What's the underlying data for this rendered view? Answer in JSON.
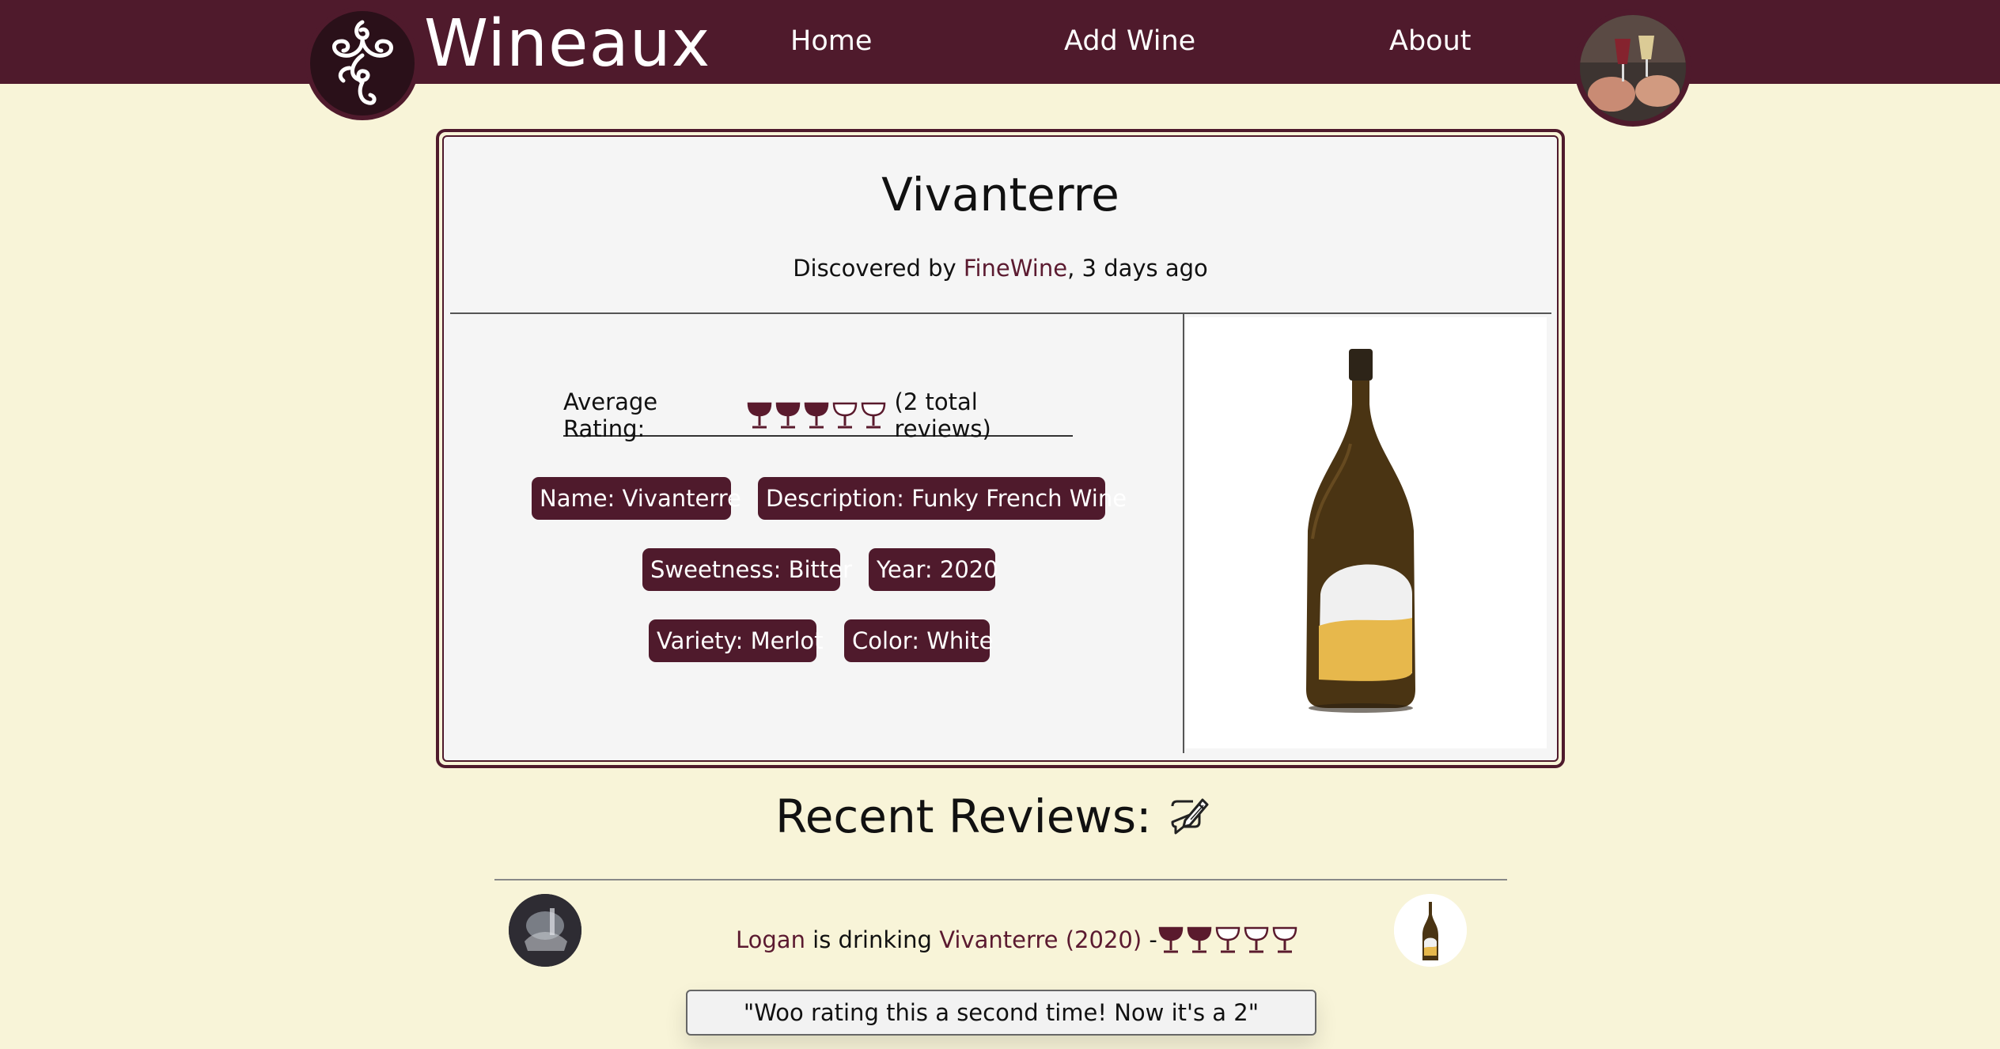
{
  "header": {
    "brand": "Wineaux",
    "nav": [
      {
        "label": "Home"
      },
      {
        "label": "Add Wine"
      },
      {
        "label": "About"
      }
    ]
  },
  "wine": {
    "title": "Vivanterre",
    "discovered_prefix": "Discovered by ",
    "discovered_user": "FineWine",
    "discovered_suffix": ", 3 days ago",
    "rating_label": "Average Rating:",
    "rating_value": 3,
    "rating_max": 5,
    "reviews_count_text": "(2 total reviews)",
    "tags": [
      {
        "text": "Name: Vivanterre"
      },
      {
        "text": "Description: Funky French Wine"
      },
      {
        "text": "Sweetness: Bitter"
      },
      {
        "text": "Year: 2020"
      },
      {
        "text": "Variety: Merlot"
      },
      {
        "text": "Color: White"
      }
    ]
  },
  "reviews": {
    "title": "Recent Reviews:",
    "items": [
      {
        "user": "Logan",
        "middle": " is drinking ",
        "wine": "Vivanterre (2020)",
        "dash": " -",
        "rating": 2,
        "rating_max": 5,
        "comment": "\"Woo rating this a second time! Now it's a 2\""
      }
    ]
  },
  "colors": {
    "accent": "#4f1a2c",
    "background": "#f8f4d8",
    "card": "#f5f5f5",
    "link": "#5b1a30"
  },
  "icons": {
    "logo": "vine-swirl-icon",
    "edit": "pencil-edit-icon",
    "rating": "wine-glass-icon"
  }
}
